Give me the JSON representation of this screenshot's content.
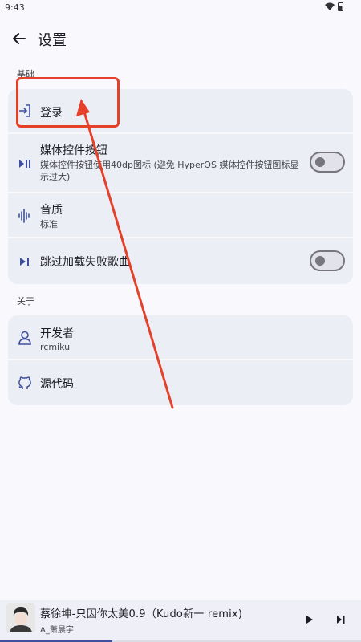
{
  "status_bar": {
    "time": "9:43"
  },
  "header": {
    "title": "设置"
  },
  "sections": [
    {
      "header": "基础"
    },
    {
      "header": "关于"
    }
  ],
  "basic_items": {
    "login": {
      "title": "登录"
    },
    "media_buttons": {
      "title": "媒体控件按钮",
      "subtitle": "媒体控件按钮使用40dp图标 (避免 HyperOS 媒体控件按钮图标显示过大)",
      "enabled": false
    },
    "audio_quality": {
      "title": "音质",
      "subtitle": "标准"
    },
    "skip_failed": {
      "title": "跳过加载失败歌曲",
      "enabled": false
    }
  },
  "about_items": {
    "developer": {
      "title": "开发者",
      "subtitle": "rcmiku"
    },
    "source": {
      "title": "源代码"
    }
  },
  "player": {
    "song_title": "蔡徐坤-只因你太美0.9（Kudo新一 remix)",
    "artist": "A_萧晨宇",
    "progress": 0.31
  },
  "colors": {
    "accent": "#3f4fa0",
    "annotation": "#e5402a"
  }
}
